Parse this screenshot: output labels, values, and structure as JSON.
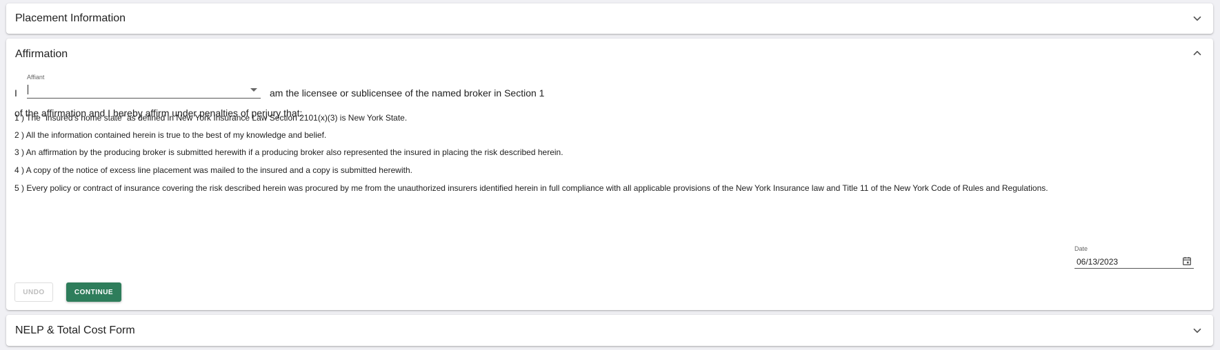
{
  "panels": {
    "placement": {
      "title": "Placement Information",
      "expanded": false
    },
    "affirmation": {
      "title": "Affirmation",
      "expanded": true
    },
    "nelp": {
      "title": "NELP & Total Cost Form",
      "expanded": false
    }
  },
  "affirmation": {
    "lead": "I",
    "affiant_label": "Affiant",
    "affiant_value": "",
    "line1_rest": "am the licensee or sublicensee of the named broker in Section 1",
    "line2": "of the affirmation and I hereby affirm under penalties of perjury that:",
    "statements": [
      "1 ) The “insured’s home state” as defined in New York Insurance Law Section 2101(x)(3) is New York State.",
      "2 ) All the information contained herein is true to the best of my knowledge and belief.",
      "3 ) An affirmation by the producing broker is submitted herewith if a producing broker also represented the insured in placing the risk described herein.",
      "4 ) A copy of the notice of excess line placement was mailed to the insured and a copy is submitted herewith.",
      "5 ) Every policy or contract of insurance covering the risk described herein was procured by me from the unauthorized insurers identified herein in full compliance with all applicable provisions of the New York Insurance law and Title 11 of the New York Code of Rules and Regulations."
    ],
    "date_label": "Date",
    "date_value": "06/13/2023",
    "undo_label": "UNDO",
    "continue_label": "CONTINUE"
  },
  "icons": {
    "collapse": "chevron-up-icon",
    "expand": "chevron-down-icon",
    "calendar": "calendar-icon"
  },
  "colors": {
    "primary": "#2e7d5b",
    "background": "#f0f0f4",
    "disabled_text": "#bdbdbd"
  }
}
